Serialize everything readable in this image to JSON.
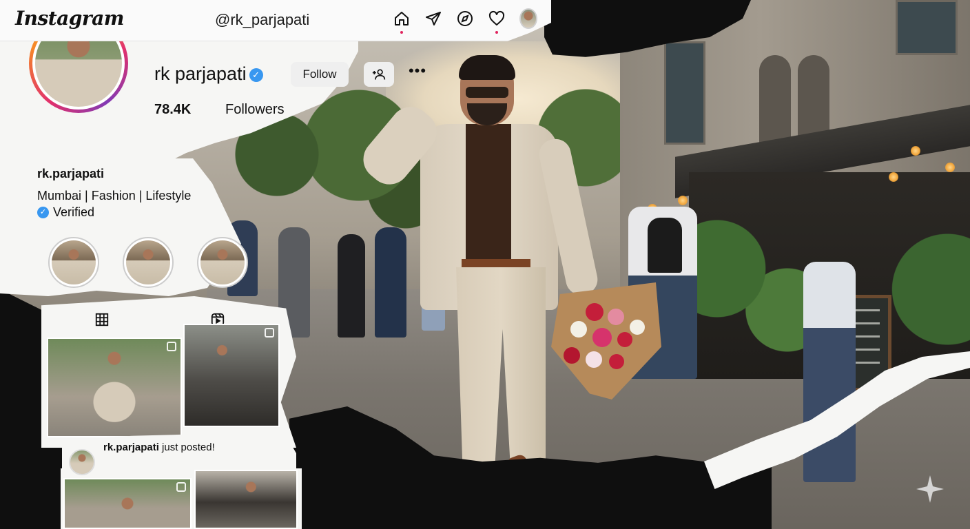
{
  "topbar": {
    "logo": "Instagram",
    "handle": "@rk_parjapati",
    "nav": [
      {
        "icon": "home-icon"
      },
      {
        "icon": "send-icon"
      },
      {
        "icon": "explore-icon"
      },
      {
        "icon": "heart-icon"
      },
      {
        "icon": "profile-avatar"
      }
    ]
  },
  "profile": {
    "name": "rk parjapati",
    "follow_label": "Follow",
    "add_user_label": "+",
    "more_label": "•••",
    "followers_count": "78.4K",
    "followers_label": "Followers",
    "username": "rk.parjapati",
    "bio": "Mumbai | Fashion | Lifestyle",
    "verified_label": "Verified"
  },
  "notification": {
    "user": "rk.parjapati",
    "message": " just posted!"
  },
  "colors": {
    "verified": "#3897f0",
    "notification_dot": "#e0245e",
    "ring_gradient": [
      "#f9c42a",
      "#e1306c",
      "#833ab4",
      "#f58529"
    ]
  }
}
